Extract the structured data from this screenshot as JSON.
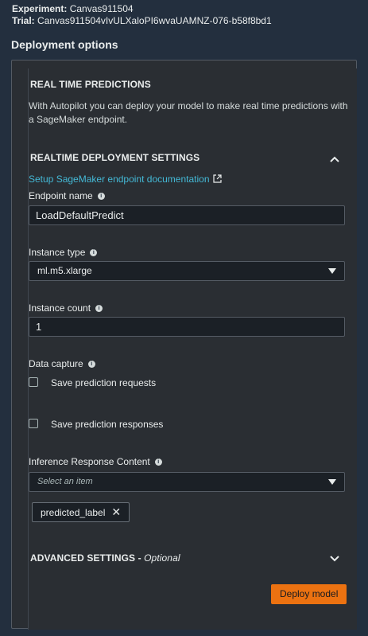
{
  "meta": {
    "experiment_label": "Experiment:",
    "experiment_value": "Canvas911504",
    "trial_label": "Trial:",
    "trial_value": "Canvas911504vIvULXaloPI6wvaUAMNZ-076-b58f8bd1"
  },
  "heading": "Deployment options",
  "realtime": {
    "title": "REAL TIME PREDICTIONS",
    "description": "With Autopilot you can deploy your model to make real time predictions with a SageMaker endpoint."
  },
  "settings": {
    "title": "REALTIME DEPLOYMENT SETTINGS",
    "doc_link": "Setup SageMaker endpoint documentation",
    "endpoint_name_label": "Endpoint name",
    "endpoint_name_value": "LoadDefaultPredict",
    "instance_type_label": "Instance type",
    "instance_type_value": "ml.m5.xlarge",
    "instance_count_label": "Instance count",
    "instance_count_value": "1",
    "data_capture_label": "Data capture",
    "save_requests_label": "Save prediction requests",
    "save_responses_label": "Save prediction responses",
    "inference_label": "Inference Response Content",
    "inference_placeholder": "Select an item",
    "inference_token": "predicted_label"
  },
  "advanced": {
    "title": "ADVANCED SETTINGS -",
    "optional": "Optional"
  },
  "deploy_button": "Deploy model",
  "info_glyph": "i",
  "close_glyph": "✕"
}
